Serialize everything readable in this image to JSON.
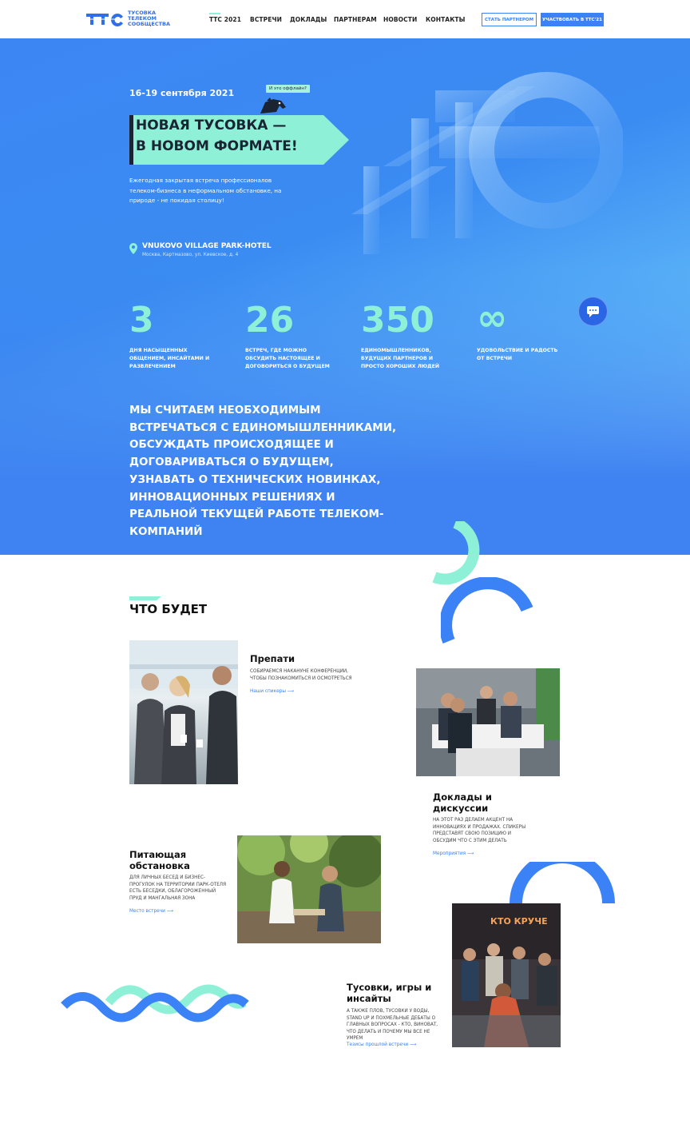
{
  "header": {
    "logo_text": "ТУСОВКА ТЕЛЕКОМ СООБЩЕСТВА",
    "nav": [
      "ТТС 2021",
      "ВСТРЕЧИ",
      "ДОКЛАДЫ",
      "ПАРТНЕРАМ",
      "НОВОСТИ",
      "КОНТАКТЫ"
    ],
    "btn_partner": "СТАТЬ ПАРТНЕРОМ",
    "btn_join": "УЧАСТВОВАТЬ В ТТС'21"
  },
  "hero": {
    "date": "16-19 сентября 2021",
    "speech": "И это оффлайн?",
    "headline_1": "НОВАЯ ТУСОВКА —",
    "headline_2": "В НОВОМ ФОРМАТЕ!",
    "desc": "Ежегодная закрытая встреча профессионалов телеком-бизнеса в неформальном обстановке, на природе - не покидая столицу!",
    "venue": "VNUKOVO VILLAGE PARK-HOTEL",
    "venue_addr": "Москва, Картмазово, ул. Киевское, д. 4"
  },
  "stats": [
    {
      "num": "3",
      "label": "дня насыщенных общением, инсайтами и развлечением"
    },
    {
      "num": "26",
      "label": "встреч, где можно обсудить настоящее и договориться о будущем"
    },
    {
      "num": "350",
      "label": "единомышленников, будущих партнеров и просто хороших людей"
    },
    {
      "num": "∞",
      "label": "удовольствие и радость от встречи"
    }
  ],
  "manifest": "Мы считаем необходимым встречаться с единомышленниками, обсуждать происходящее и договариваться о будущем, узнавать о технических новинках, инновационных решениях и реальной текущей работе телеком-компаний",
  "section": {
    "title": "ЧТО БУДЕТ",
    "items": [
      {
        "title": "Препати",
        "text": "Собираемся накануне конференции, чтобы познакомиться и осмотреться",
        "link": "Наши спикеры"
      },
      {
        "title": "Доклады и дискуссии",
        "text": "На этот раз делаем акцент на инновациях и продажах. Спикеры представят свою позицию и обсудим что с этим делать",
        "link": "Мероприятия"
      },
      {
        "title": "Питающая обстановка",
        "text": "Для личных бесед и бизнес-прогулок на территории парк-отеля есть беседки, облагороженный пруд и мангальная зона",
        "link": "Место встречи"
      },
      {
        "title": "Тусовки, игры и инсайты",
        "text": "А также плов, тусовки у воды, stand up и похмельные дебаты о главных вопросах - кто, виноват, что делать и почему мы все не умрем",
        "link": "Тезисы прошлой встречи"
      }
    ]
  },
  "sign_text": "КТО КРУЧЕ"
}
